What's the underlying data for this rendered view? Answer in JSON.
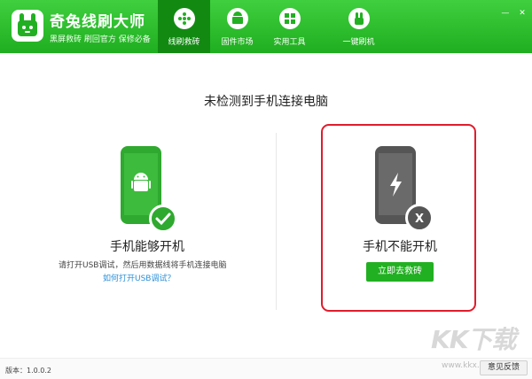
{
  "colors": {
    "brand_green": "#22b022",
    "active_tab": "#128a12",
    "highlight_border": "#e01c2c",
    "link": "#2a8fd8"
  },
  "header": {
    "app_name": "奇兔线刷大师",
    "slogan": "黑屏救砖  刷回官方  保修必备",
    "tabs": [
      {
        "label": "线刷救砖",
        "icon": "plus-dots-icon",
        "active": true
      },
      {
        "label": "固件市场",
        "icon": "android-box-icon",
        "active": false
      },
      {
        "label": "实用工具",
        "icon": "grid-icon",
        "active": false
      },
      {
        "label": "一键刷机",
        "icon": "rabbit-icon",
        "active": false
      }
    ],
    "window_controls": [
      "minimize-icon",
      "close-icon"
    ]
  },
  "main": {
    "title": "未检测到手机连接电脑",
    "option_on": {
      "title": "手机能够开机",
      "desc": "请打开USB调试，然后用数据线将手机连接电脑",
      "link": "如何打开USB调试？",
      "icon": "android-phone-icon",
      "badge_icon": "check-icon"
    },
    "option_off": {
      "title": "手机不能开机",
      "button": "立即去救砖",
      "icon": "power-phone-icon",
      "badge_text": "X"
    }
  },
  "footer": {
    "version": "版本：1.0.0.2",
    "watermark_logo": "KK下载",
    "watermark_url": "www.kkx.net",
    "feedback": "意见反馈"
  }
}
